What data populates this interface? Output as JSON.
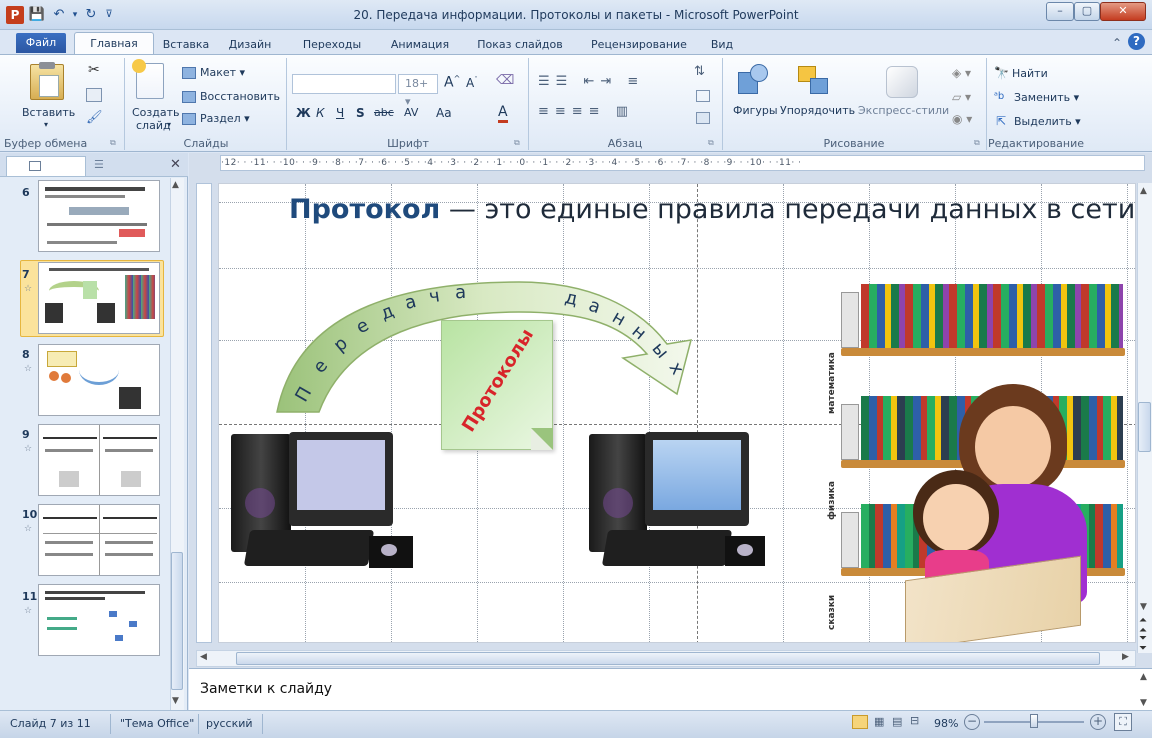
{
  "window": {
    "title": "20. Передача информации. Протоколы и пакеты  -  Microsoft PowerPoint",
    "app_icon_letter": "P"
  },
  "tabs": [
    "Файл",
    "Главная",
    "Вставка",
    "Дизайн",
    "Переходы",
    "Анимация",
    "Показ слайдов",
    "Рецензирование",
    "Вид"
  ],
  "ribbon": {
    "clipboard": {
      "paste": "Вставить",
      "label": "Буфер обмена"
    },
    "slides": {
      "new_slide_1": "Создать",
      "new_slide_2": "слайд",
      "layout": "Макет",
      "reset": "Восстановить",
      "section": "Раздел",
      "label": "Слайды"
    },
    "font": {
      "size": "18+",
      "label": "Шрифт",
      "bold": "Ж",
      "italic": "К",
      "underline": "Ч",
      "shadow": "S",
      "strike": "abc",
      "aa": "Aa",
      "A": "A"
    },
    "paragraph": {
      "label": "Абзац"
    },
    "drawing": {
      "shapes": "Фигуры",
      "arrange": "Упорядочить",
      "quick_styles": "Экспресс-стили",
      "label": "Рисование"
    },
    "editing": {
      "find": "Найти",
      "replace": "Заменить",
      "select": "Выделить",
      "label": "Редактирование"
    }
  },
  "slides_panel": {
    "items": [
      {
        "num": "6"
      },
      {
        "num": "7"
      },
      {
        "num": "8"
      },
      {
        "num": "9"
      },
      {
        "num": "10"
      },
      {
        "num": "11"
      }
    ],
    "selected": "7"
  },
  "ruler": {
    "h": "·12·  ·  ·11·  ·  ·10·  ·  ·9·  ·  ·8·  ·  ·7·  ·  ·6·  ·  ·5·  ·  ·4·  ·  ·3·  ·  ·2·  ·  ·1·  ·  ·0·  ·  ·1·  ·  ·2·  ·  ·3·  ·  ·4·  ·  ·5·  ·  ·6·  ·  ·7·  ·  ·8·  ·  ·9·  ·  ·10·  ·  ·11·  ·"
  },
  "slide": {
    "title_bold": "Протокол",
    "title_rest": " — это единые правила передачи данных в сети",
    "arc_letters": [
      "П",
      "е",
      "р",
      "е",
      "д",
      "а",
      "ч",
      "а",
      "д",
      "а",
      "н",
      "н",
      "ы",
      "х"
    ],
    "note_text": "Протоколы",
    "shelves": [
      "математика",
      "физика",
      "сказки"
    ]
  },
  "notes": {
    "placeholder": "Заметки к слайду"
  },
  "status": {
    "slide": "Слайд 7 из 11",
    "theme": "\"Тема Office\"",
    "lang": "русский",
    "zoom": "98%"
  }
}
